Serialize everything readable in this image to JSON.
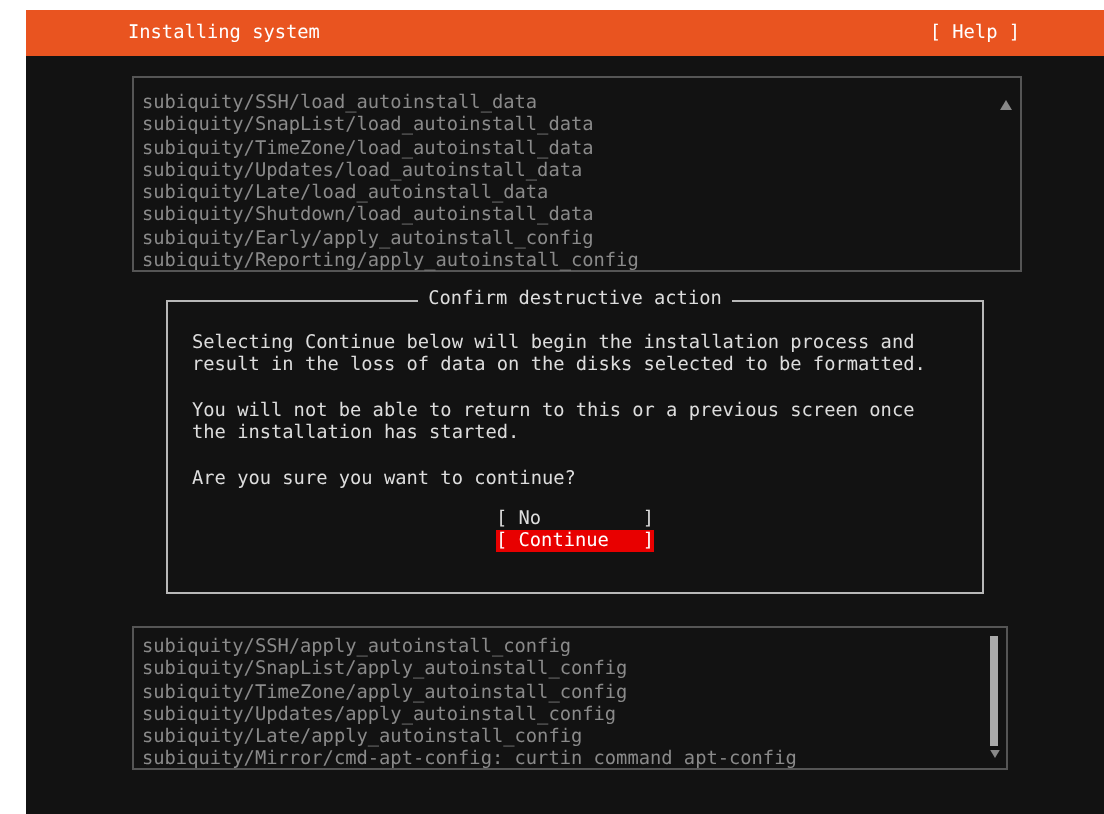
{
  "header": {
    "title": "Installing system",
    "help": "[ Help ]"
  },
  "log_top": [
    "subiquity/SSH/load_autoinstall_data",
    "subiquity/SnapList/load_autoinstall_data",
    "subiquity/TimeZone/load_autoinstall_data",
    "subiquity/Updates/load_autoinstall_data",
    "subiquity/Late/load_autoinstall_data",
    "subiquity/Shutdown/load_autoinstall_data",
    "subiquity/Early/apply_autoinstall_config",
    "subiquity/Reporting/apply_autoinstall_config"
  ],
  "dialog": {
    "title": "Confirm destructive action",
    "paragraphs": [
      "Selecting Continue below will begin the installation process and result in the loss of data on the disks selected to be formatted.",
      "You will not be able to return to this or a previous screen once the installation has started.",
      "Are you sure you want to continue?"
    ],
    "buttons": [
      {
        "label": "[ No         ]",
        "selected": false
      },
      {
        "label": "[ Continue   ]",
        "selected": true
      }
    ]
  },
  "log_bottom": [
    "subiquity/SSH/apply_autoinstall_config",
    "subiquity/SnapList/apply_autoinstall_config",
    "subiquity/TimeZone/apply_autoinstall_config",
    "subiquity/Updates/apply_autoinstall_config",
    "subiquity/Late/apply_autoinstall_config",
    "subiquity/Mirror/cmd-apt-config: curtin command apt-config"
  ]
}
